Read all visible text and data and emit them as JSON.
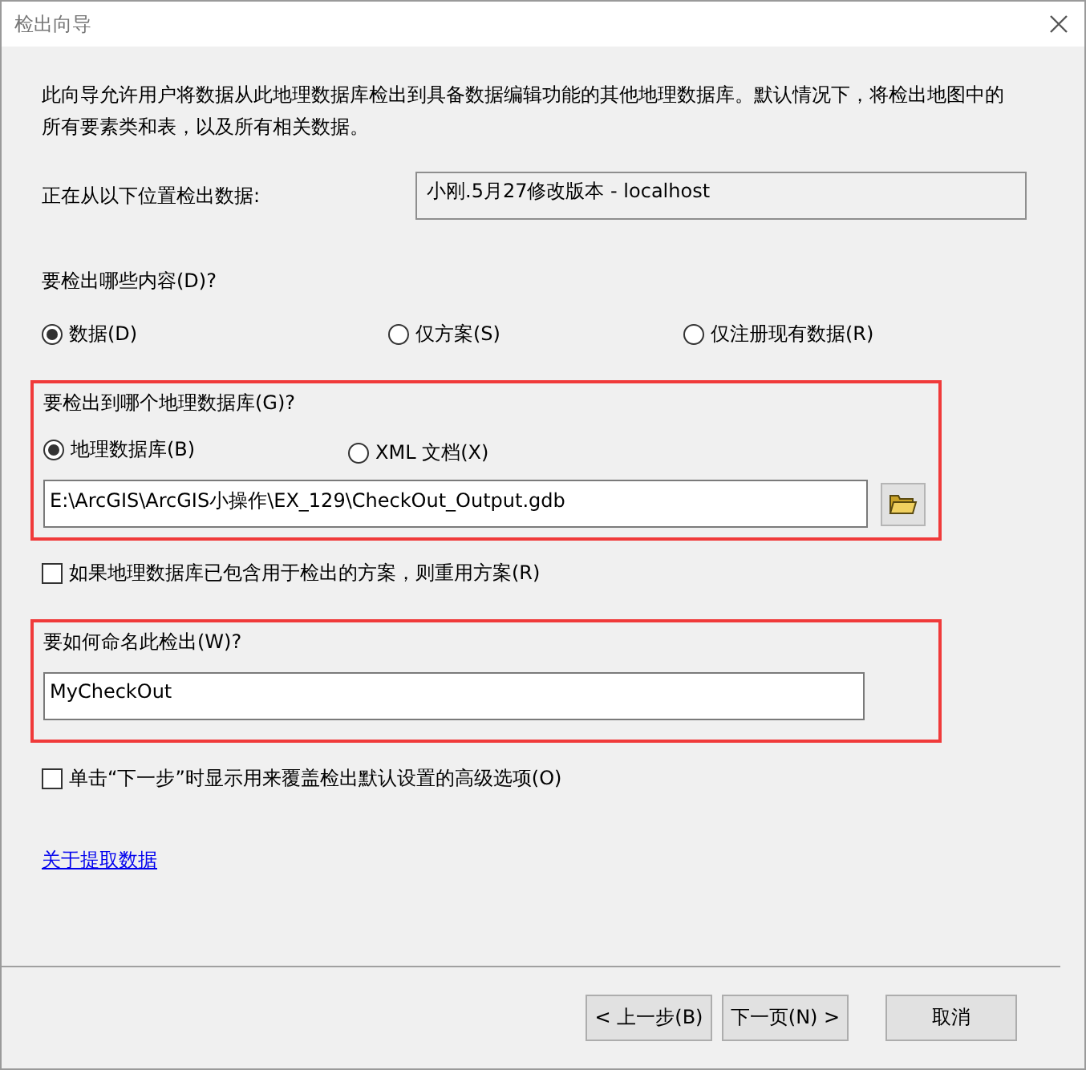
{
  "window": {
    "title": "检出向导"
  },
  "description": "此向导允许用户将数据从此地理数据库检出到具备数据编辑功能的其他地理数据库。默认情况下，将检出地图中的所有要素类和表，以及所有相关数据。",
  "source": {
    "label": "正在从以下位置检出数据:",
    "value": "小刚.5月27修改版本 - localhost"
  },
  "content": {
    "label": "要检出哪些内容(D)?",
    "options": [
      {
        "label": "数据(D)",
        "selected": true
      },
      {
        "label": "仅方案(S)",
        "selected": false
      },
      {
        "label": "仅注册现有数据(R)",
        "selected": false
      }
    ]
  },
  "target": {
    "highlighted": true,
    "label": "要检出到哪个地理数据库(G)?",
    "options": [
      {
        "label": "地理数据库(B)",
        "selected": true
      },
      {
        "label": "XML 文档(X)",
        "selected": false
      }
    ],
    "path": "E:\\ArcGIS\\ArcGIS小操作\\EX_129\\CheckOut_Output.gdb"
  },
  "reuse_schema": {
    "label": "如果地理数据库已包含用于检出的方案，则重用方案(R)",
    "checked": false
  },
  "name": {
    "highlighted": true,
    "label": "要如何命名此检出(W)?",
    "value": "MyCheckOut"
  },
  "advanced": {
    "label": "单击“下一步”时显示用来覆盖检出默认设置的高级选项(O)",
    "checked": false
  },
  "link": "关于提取数据",
  "buttons": [
    "< 上一步(B)",
    "下一页(N) >",
    "取消"
  ]
}
